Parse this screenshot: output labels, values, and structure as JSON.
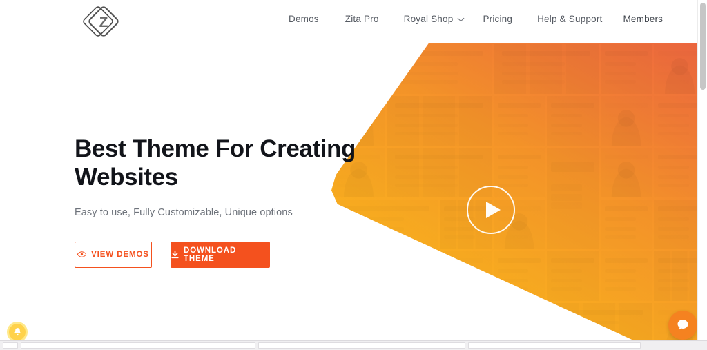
{
  "header": {
    "logo": {
      "name": "zita-logo",
      "letter": "Z"
    },
    "nav": [
      {
        "label": "Demos",
        "has_dropdown": false
      },
      {
        "label": "Zita Pro",
        "has_dropdown": false
      },
      {
        "label": "Royal Shop",
        "has_dropdown": true
      },
      {
        "label": "Pricing",
        "has_dropdown": false
      },
      {
        "label": "Help & Support",
        "has_dropdown": false
      },
      {
        "label": "Members",
        "has_dropdown": false
      }
    ]
  },
  "hero": {
    "title": "Best Theme For Creating Websites",
    "subtitle": "Easy to use, Fully Customizable, Unique options",
    "buttons": {
      "view_demos": {
        "label": "VIEW DEMOS",
        "icon": "eye-icon"
      },
      "download_theme": {
        "label": "DOWNLOAD THEME",
        "icon": "download-icon"
      }
    },
    "play_button": {
      "name": "play-video-button",
      "icon": "play-icon"
    }
  },
  "widgets": {
    "notification": {
      "name": "notification-bell-button",
      "icon": "bell-icon"
    },
    "chat": {
      "name": "chat-widget-button",
      "icon": "chat-bubble-icon"
    }
  },
  "colors": {
    "accent_orange": "#F4511E",
    "hero_gradient_start": "#EF6B3E",
    "hero_gradient_end": "#FEC113",
    "chat_orange": "#F58220",
    "notification_yellow": "#FFD24A",
    "nav_text": "#555A62",
    "heading": "#12141A",
    "subtitle": "#6E737B"
  }
}
